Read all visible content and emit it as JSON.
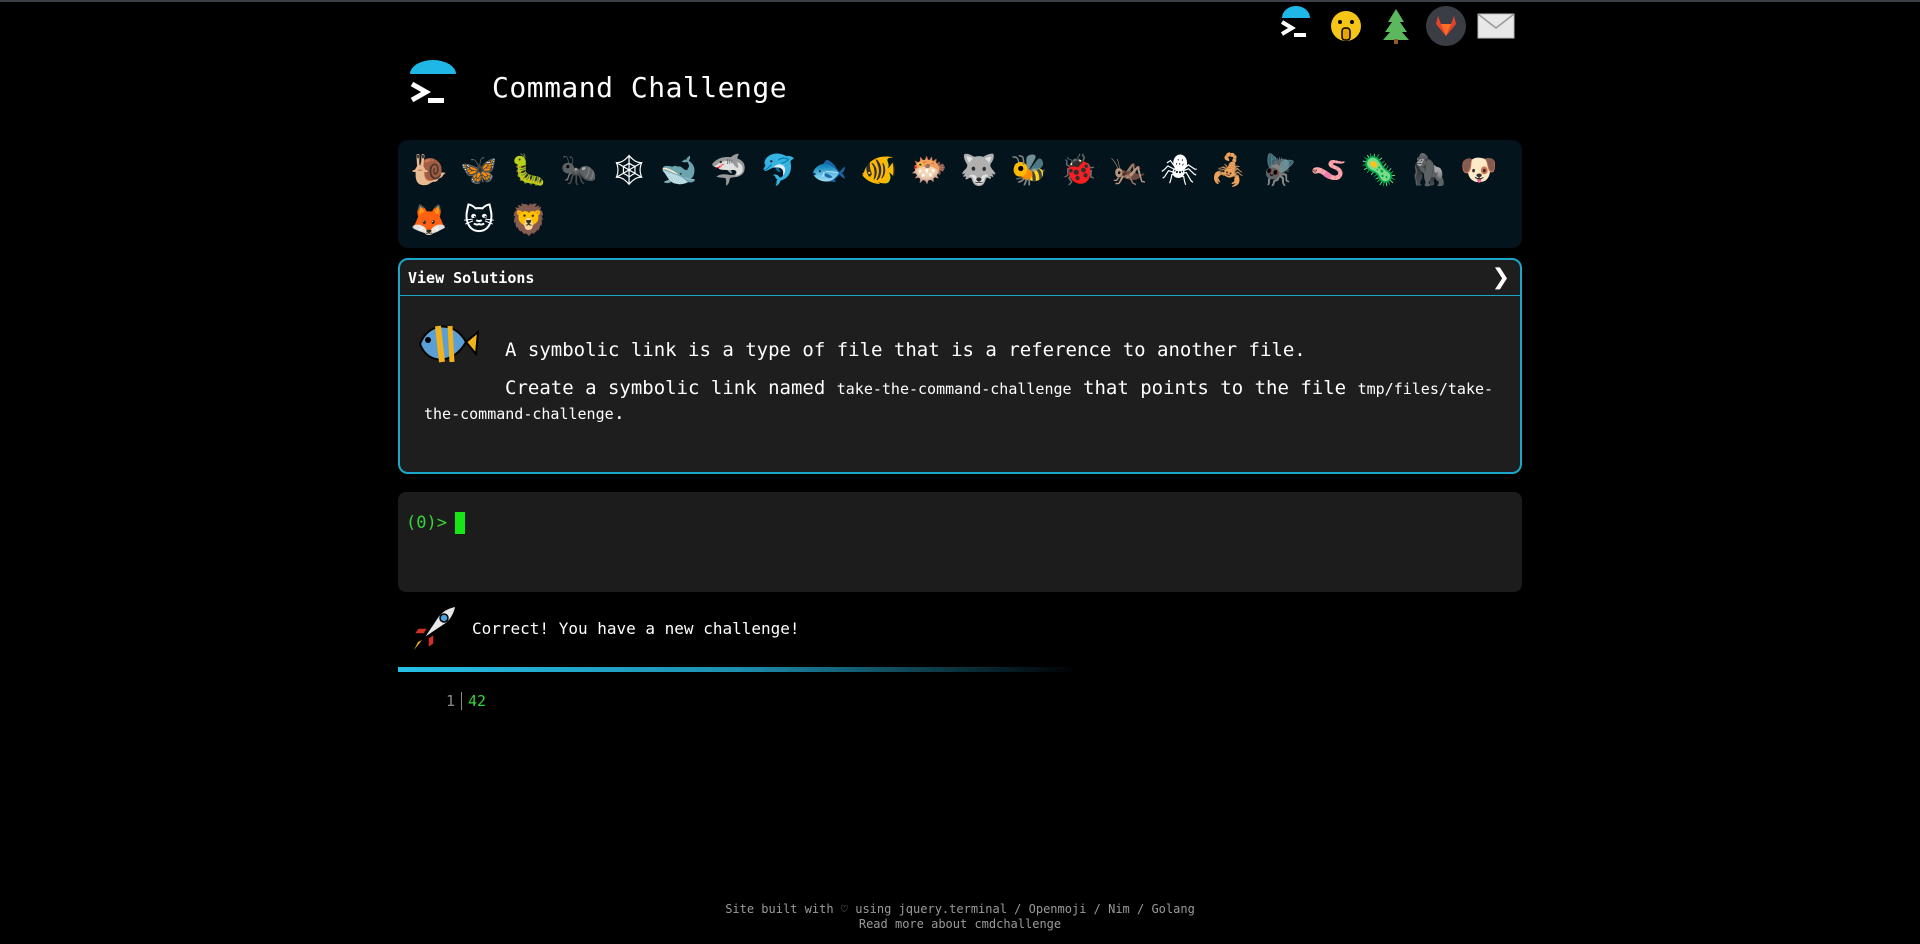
{
  "header": {
    "title": "Command Challenge"
  },
  "top_icons": [
    "terminal-icon",
    "shushing-face-icon",
    "tree-icon",
    "gitlab-icon",
    "envelope-icon"
  ],
  "animals": [
    {
      "name": "snail",
      "glyph": "🐌"
    },
    {
      "name": "butterfly",
      "glyph": "🦋"
    },
    {
      "name": "caterpillar",
      "glyph": "🐛"
    },
    {
      "name": "ant",
      "glyph": "🐜"
    },
    {
      "name": "spider-web",
      "glyph": "🕸"
    },
    {
      "name": "whale",
      "glyph": "🐋"
    },
    {
      "name": "shark",
      "glyph": "🦈"
    },
    {
      "name": "dolphin",
      "glyph": "🐬"
    },
    {
      "name": "fish",
      "glyph": "🐟"
    },
    {
      "name": "tropical-fish",
      "glyph": "🐠"
    },
    {
      "name": "blowfish",
      "glyph": "🐡"
    },
    {
      "name": "wolf",
      "glyph": "🐺"
    },
    {
      "name": "bee",
      "glyph": "🐝"
    },
    {
      "name": "ladybug",
      "glyph": "🐞"
    },
    {
      "name": "cricket",
      "glyph": "🦗"
    },
    {
      "name": "spider",
      "glyph": "🕷"
    },
    {
      "name": "scorpion",
      "glyph": "🦂"
    },
    {
      "name": "fly",
      "glyph": "🪰"
    },
    {
      "name": "worm",
      "glyph": "🪱"
    },
    {
      "name": "microbe",
      "glyph": "🦠"
    },
    {
      "name": "gorilla",
      "glyph": "🦍"
    },
    {
      "name": "dog",
      "glyph": "🐶"
    },
    {
      "name": "fox",
      "glyph": "🦊"
    },
    {
      "name": "cat",
      "glyph": "🐱"
    },
    {
      "name": "lion",
      "glyph": "🦁"
    }
  ],
  "panel": {
    "toggle_label": "View Solutions",
    "chevron": "❯",
    "intro": "A symbolic link is a type of file that is a reference to another file.",
    "task_prefix": "Create a symbolic link named",
    "task_link_name": "take-the-command-challenge",
    "task_middle": "that points to the file",
    "task_target": "tmp/files/take-the-command-challenge",
    "task_suffix": "."
  },
  "terminal": {
    "prompt": "(0)>"
  },
  "message": {
    "text": "Correct! You have a new challenge!"
  },
  "output": {
    "line_number": "1",
    "value": "42"
  },
  "footer": {
    "line1": "Site built with ♡ using jquery.terminal / Openmoji / Nim / Golang",
    "line2": "Read more about cmdchallenge"
  },
  "colors": {
    "accent": "#1aa7c9",
    "terminal_green": "#33d633",
    "cursor": "#16e516"
  }
}
